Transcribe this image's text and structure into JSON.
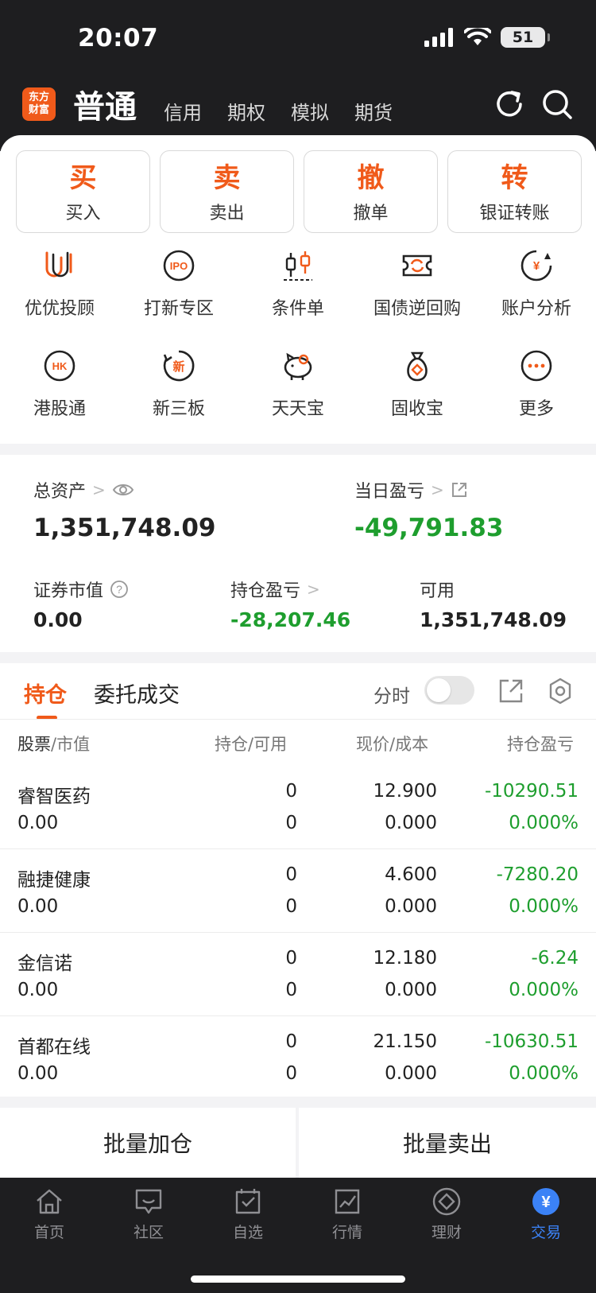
{
  "status": {
    "time": "20:07",
    "battery": "51"
  },
  "nav": {
    "logo_line1": "东方",
    "logo_line2": "财富",
    "active": "普通",
    "tabs": [
      "信用",
      "期权",
      "模拟",
      "期货"
    ]
  },
  "actions": [
    {
      "big": "买",
      "small": "买入"
    },
    {
      "big": "卖",
      "small": "卖出"
    },
    {
      "big": "撤",
      "small": "撤单"
    },
    {
      "big": "转",
      "small": "银证转账"
    }
  ],
  "shortcuts": [
    {
      "label": "优优投顾",
      "icon": "uu-advisor-icon"
    },
    {
      "label": "打新专区",
      "icon": "ipo-icon"
    },
    {
      "label": "条件单",
      "icon": "candlestick-icon"
    },
    {
      "label": "国债逆回购",
      "icon": "repo-ticket-icon"
    },
    {
      "label": "账户分析",
      "icon": "yen-chat-icon"
    },
    {
      "label": "港股通",
      "icon": "hk-icon"
    },
    {
      "label": "新三板",
      "icon": "new-board-icon"
    },
    {
      "label": "天天宝",
      "icon": "piggy-bank-icon"
    },
    {
      "label": "固收宝",
      "icon": "money-bag-icon"
    },
    {
      "label": "更多",
      "icon": "more-icon"
    }
  ],
  "assets": {
    "total_label": "总资产",
    "total_value": "1,351,748.09",
    "daily_label": "当日盈亏",
    "daily_value": "-49,791.83",
    "securities_label": "证券市值",
    "securities_value": "0.00",
    "position_pnl_label": "持仓盈亏",
    "position_pnl_value": "-28,207.46",
    "available_label": "可用",
    "available_value": "1,351,748.09"
  },
  "positions": {
    "tab_active": "持仓",
    "tab_other": "委托成交",
    "toggle_label": "分时",
    "headers": {
      "stock": "股票",
      "market_value": "/市值",
      "hold": "持仓",
      "available": "/可用",
      "price": "现价",
      "cost": "/成本",
      "pnl": "持仓盈亏"
    },
    "rows": [
      {
        "name": "睿智医药",
        "mv": "0.00",
        "hold": "0",
        "avail": "0",
        "price": "12.900",
        "cost": "0.000",
        "pnl": "-10290.51",
        "pct": "0.000%"
      },
      {
        "name": "融捷健康",
        "mv": "0.00",
        "hold": "0",
        "avail": "0",
        "price": "4.600",
        "cost": "0.000",
        "pnl": "-7280.20",
        "pct": "0.000%"
      },
      {
        "name": "金信诺",
        "mv": "0.00",
        "hold": "0",
        "avail": "0",
        "price": "12.180",
        "cost": "0.000",
        "pnl": "-6.24",
        "pct": "0.000%"
      },
      {
        "name": "首都在线",
        "mv": "0.00",
        "hold": "0",
        "avail": "0",
        "price": "21.150",
        "cost": "0.000",
        "pnl": "-10630.51",
        "pct": "0.000%"
      }
    ]
  },
  "bulk": {
    "add": "批量加仓",
    "sell": "批量卖出"
  },
  "tabbar": [
    {
      "label": "首页"
    },
    {
      "label": "社区"
    },
    {
      "label": "自选"
    },
    {
      "label": "行情"
    },
    {
      "label": "理财"
    },
    {
      "label": "交易"
    }
  ],
  "colors": {
    "accent": "#f05a1a",
    "gain_loss": "#1e9e2e",
    "tab_active": "#3b82f6"
  }
}
